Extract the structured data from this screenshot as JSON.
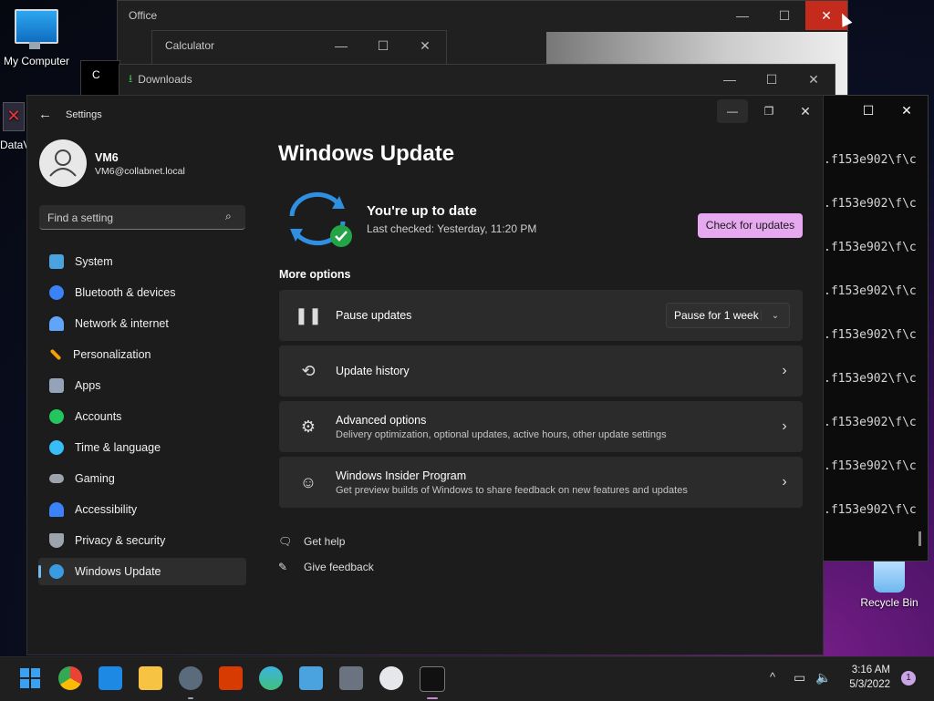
{
  "desktop": {
    "icons": [
      {
        "label": "My Computer"
      },
      {
        "label": "DataV"
      },
      {
        "label": "Recycle Bin"
      }
    ]
  },
  "bg_windows": {
    "office_title": "Office",
    "calculator_title": "Calculator",
    "downloads_title": "Downloads",
    "partial_tab": "C"
  },
  "console": {
    "lines": [
      ".f153e902\\f\\c",
      ".f153e902\\f\\c",
      ".f153e902\\f\\c",
      ".f153e902\\f\\c",
      ".f153e902\\f\\c",
      ".f153e902\\f\\c",
      ".f153e902\\f\\c",
      ".f153e902\\f\\c",
      ".f153e902\\f\\c"
    ]
  },
  "settings": {
    "app_title": "Settings",
    "user": {
      "name": "VM6",
      "email": "VM6@collabnet.local"
    },
    "search_placeholder": "Find a setting",
    "nav": [
      {
        "label": "System",
        "color": "#4aa3df"
      },
      {
        "label": "Bluetooth & devices",
        "color": "#3b82f6"
      },
      {
        "label": "Network & internet",
        "color": "#60a5fa"
      },
      {
        "label": "Personalization",
        "color": "#f59e0b"
      },
      {
        "label": "Apps",
        "color": "#94a3b8"
      },
      {
        "label": "Accounts",
        "color": "#22c55e"
      },
      {
        "label": "Time & language",
        "color": "#38bdf8"
      },
      {
        "label": "Gaming",
        "color": "#9ca3af"
      },
      {
        "label": "Accessibility",
        "color": "#3b82f6"
      },
      {
        "label": "Privacy & security",
        "color": "#9ca3af"
      },
      {
        "label": "Windows Update",
        "color": "#3b9be0"
      }
    ],
    "page_title": "Windows Update",
    "status_title": "You're up to date",
    "status_sub": "Last checked: Yesterday, 11:20 PM",
    "check_button": "Check for updates",
    "more_options": "More options",
    "pause": {
      "title": "Pause updates",
      "select": "Pause for 1 week"
    },
    "history": {
      "title": "Update history"
    },
    "advanced": {
      "title": "Advanced options",
      "sub": "Delivery optimization, optional updates, active hours, other update settings"
    },
    "insider": {
      "title": "Windows Insider Program",
      "sub": "Get preview builds of Windows to share feedback on new features and updates"
    },
    "get_help": "Get help",
    "give_feedback": "Give feedback"
  },
  "taskbar": {
    "time": "3:16 AM",
    "date": "5/3/2022",
    "notification_count": "1"
  }
}
